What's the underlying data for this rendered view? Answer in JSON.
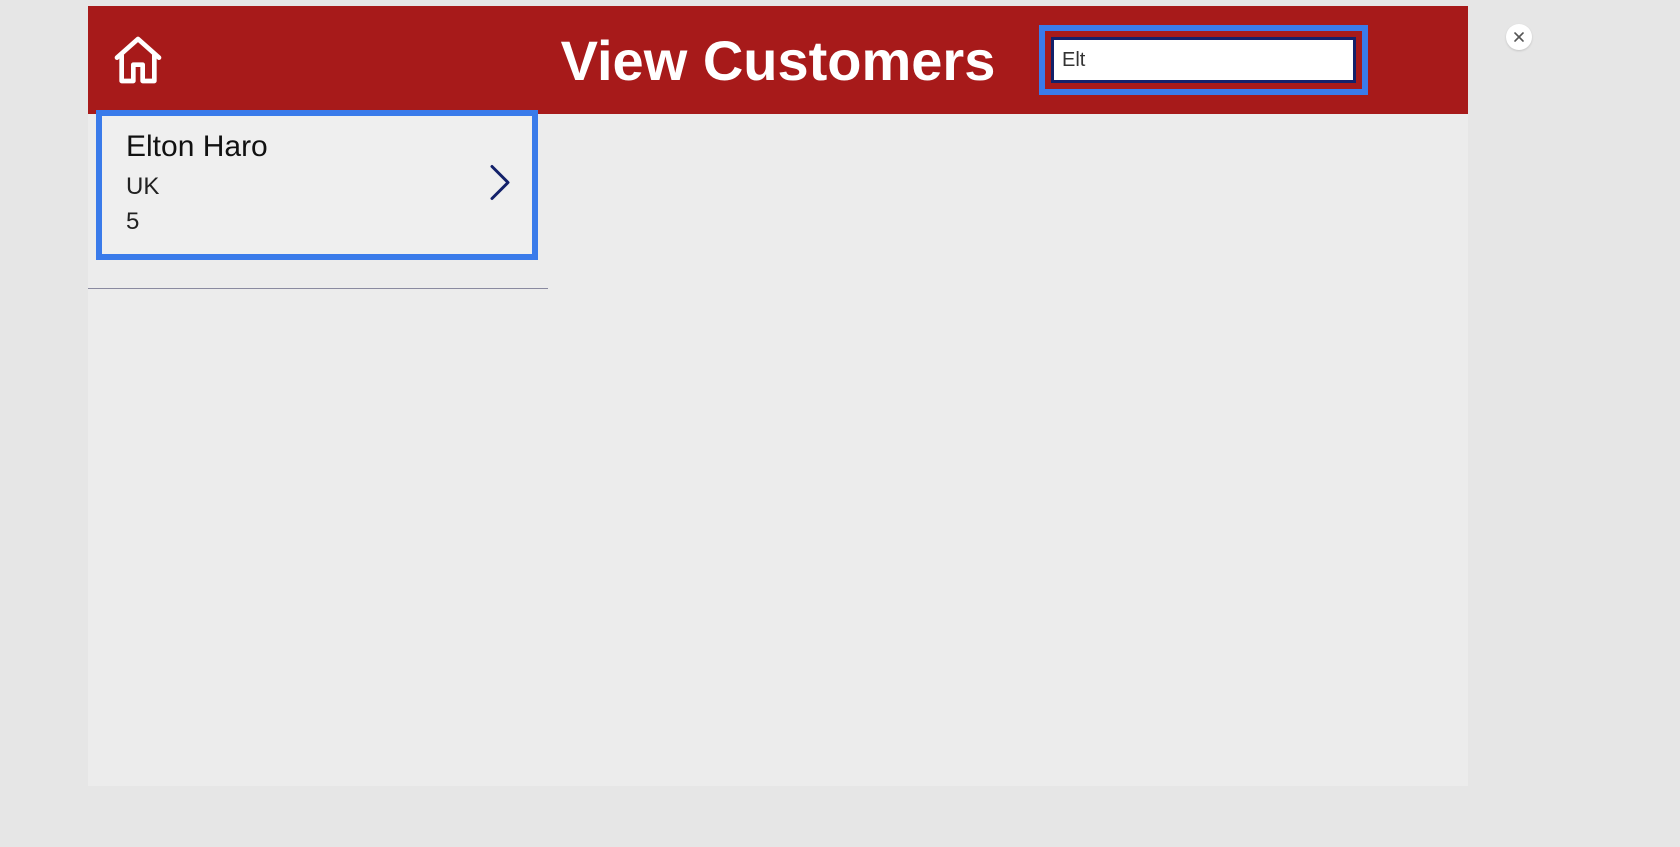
{
  "header": {
    "title": "View Customers",
    "search_value": "Elt"
  },
  "results": [
    {
      "name": "Elton  Haro",
      "line1": "UK",
      "line2": "5"
    }
  ],
  "colors": {
    "header_bg": "#a71a1a",
    "highlight": "#3a7bea",
    "input_border": "#13216a"
  }
}
